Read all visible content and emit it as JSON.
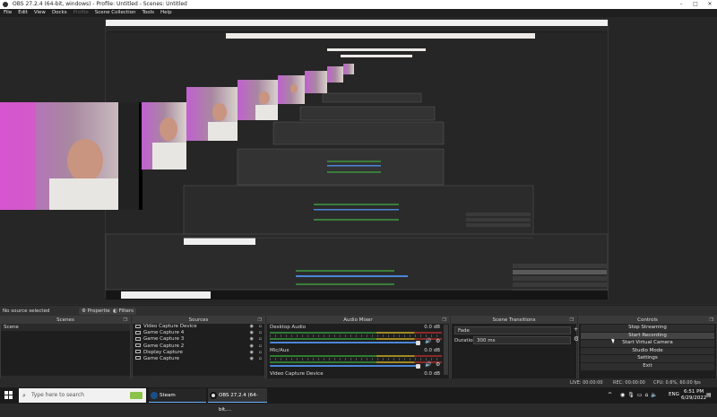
{
  "window": {
    "title": "OBS 27.2.4 (64-bit, windows) - Profile: Untitled - Scenes: Untitled",
    "controls": [
      "–",
      "□",
      "✕"
    ]
  },
  "menu": [
    "File",
    "Edit",
    "View",
    "Docks",
    "Profile",
    "Scene Collection",
    "Tools",
    "Help"
  ],
  "status_line": {
    "source": "No source selected",
    "properties": "Properties",
    "filters": "Filters"
  },
  "scenes": {
    "title": "Scenes",
    "items": [
      "Scene"
    ]
  },
  "sources": {
    "title": "Sources",
    "items": [
      "Video Capture Device",
      "Game Capture 4",
      "Game Capture 3",
      "Game Capture 2",
      "Display Capture",
      "Game Capture"
    ]
  },
  "mixer": {
    "title": "Audio Mixer",
    "channels": [
      {
        "name": "Desktop Audio",
        "db": "0.0 dB"
      },
      {
        "name": "Mic/Aux",
        "db": "0.0 dB"
      },
      {
        "name": "Video Capture Device",
        "db": "0.0 dB"
      }
    ]
  },
  "transitions": {
    "title": "Scene Transitions",
    "type": "Fade",
    "duration_label": "Duration",
    "duration": "300 ms"
  },
  "controls": {
    "title": "Controls",
    "buttons": [
      "Stop Streaming",
      "Start Recording",
      "Start Virtual Camera",
      "Studio Mode",
      "Settings",
      "Exit"
    ]
  },
  "obs_status": {
    "live": "LIVE: 00:00:00",
    "rec": "REC: 00:00:00",
    "cpu": "CPU: 0.6%, 60.00 fps"
  },
  "taskbar": {
    "search_placeholder": "Type here to search",
    "apps": [
      "Steam",
      "OBS 27.2.4 (64-bit,..."
    ],
    "lang": "ENG",
    "time": "6:51 PM",
    "date": "6/29/2022"
  }
}
